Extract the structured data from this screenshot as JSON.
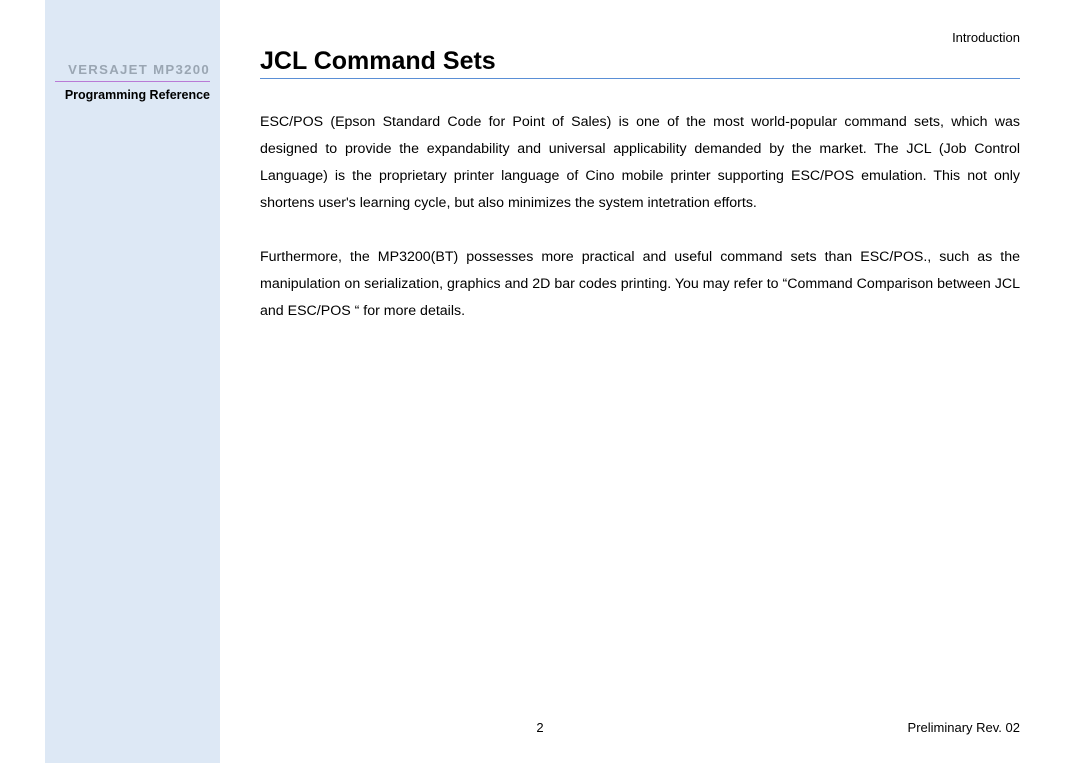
{
  "sidebar": {
    "product": "VERSAJET MP3200",
    "subtitle": "Programming Reference"
  },
  "header": {
    "section": "Introduction"
  },
  "main": {
    "title": "JCL Command Sets",
    "paragraph1": "ESC/POS (Epson Standard Code for Point of Sales) is one of the most world-popular command sets, which was designed to provide the expandability and universal applicability demanded by the market. The JCL (Job Control Language) is the proprietary printer language of Cino mobile printer supporting ESC/POS emulation. This not only shortens user's learning cycle, but also minimizes the system intetration efforts.",
    "paragraph2": "Furthermore, the MP3200(BT) possesses more practical and useful command sets than ESC/POS., such as the manipulation on serialization, graphics and 2D bar codes printing. You may refer to “Command Comparison between JCL and ESC/POS “ for more details."
  },
  "footer": {
    "page": "2",
    "revision": "Preliminary Rev. 02"
  }
}
